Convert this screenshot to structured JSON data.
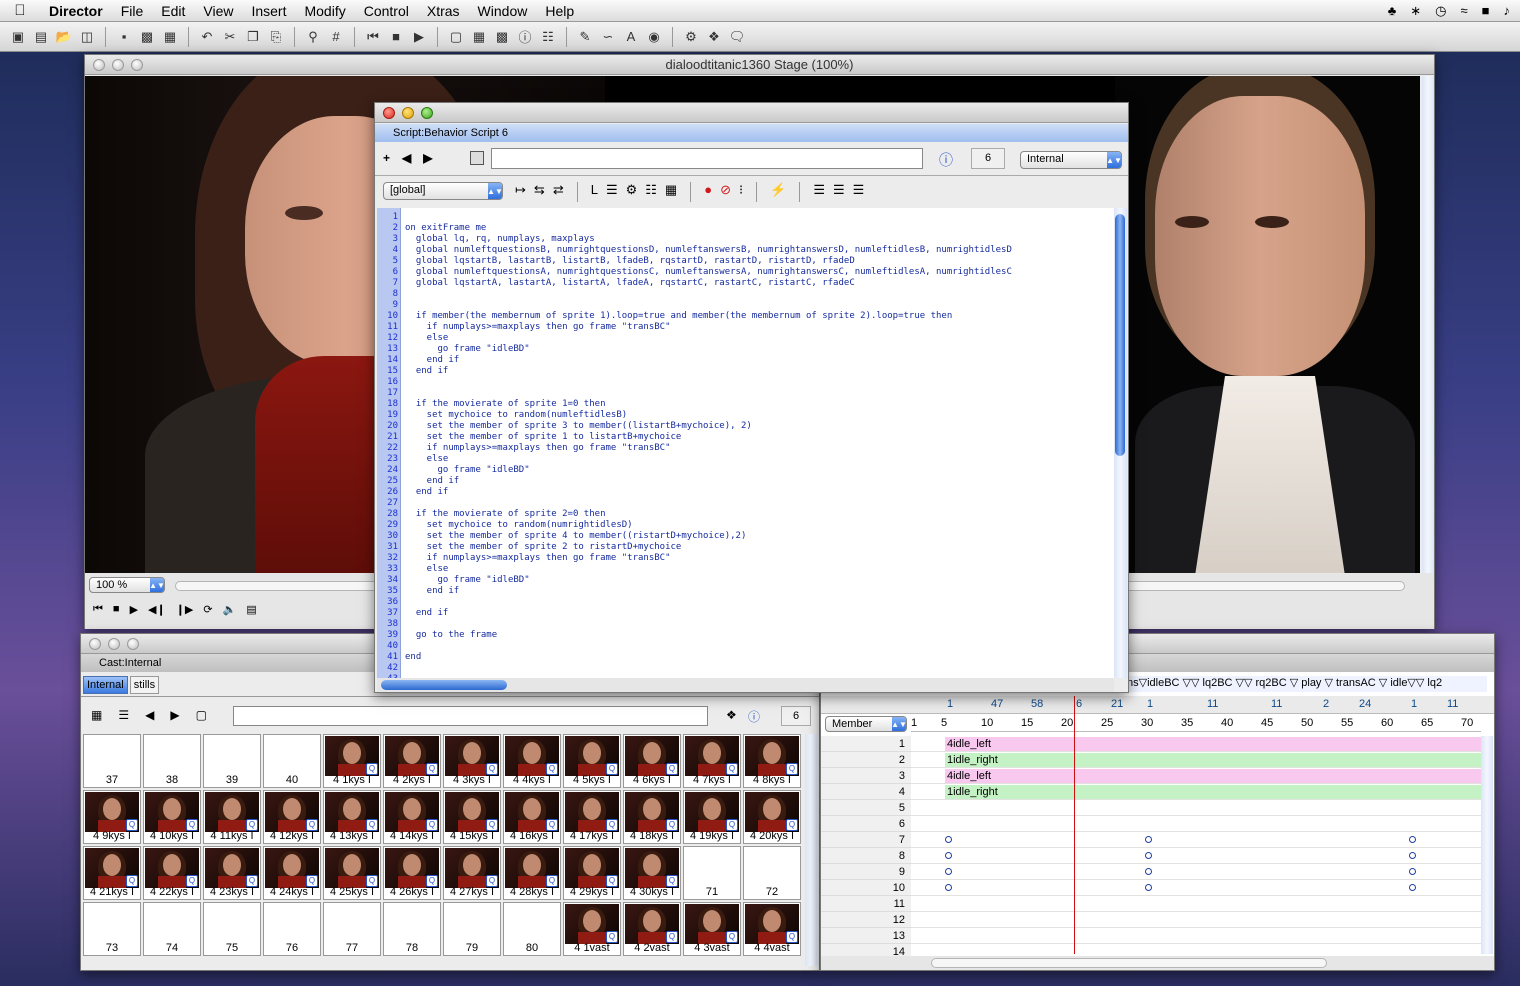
{
  "menubar": {
    "app": "Director",
    "items": [
      "File",
      "Edit",
      "View",
      "Insert",
      "Modify",
      "Control",
      "Xtras",
      "Window",
      "Help"
    ]
  },
  "stage": {
    "title": "dialoodtitanic1360 Stage (100%)",
    "zoom": "100 %"
  },
  "script": {
    "title": "Script:Behavior Script 6",
    "cast_number": "6",
    "cast_lib": "Internal",
    "handler_scope": "[global]",
    "line_numbers": [
      "1",
      "2",
      "3",
      "4",
      "5",
      "6",
      "7",
      "8",
      "9",
      "10",
      "11",
      "12",
      "13",
      "14",
      "15",
      "16",
      "17",
      "18",
      "19",
      "20",
      "21",
      "22",
      "23",
      "24",
      "25",
      "26",
      "27",
      "28",
      "29",
      "30",
      "31",
      "32",
      "33",
      "34",
      "35",
      "36",
      "37",
      "38",
      "39",
      "40",
      "41",
      "42",
      "43"
    ],
    "lines": [
      "",
      "on exitFrame me",
      "  global lq, rq, numplays, maxplays",
      "  global numleftquestionsB, numrightquestionsD, numleftanswersB, numrightanswersD, numleftidlesB, numrightidlesD",
      "  global lqstartB, lastartB, listartB, lfadeB, rqstartD, rastartD, ristartD, rfadeD",
      "  global numleftquestionsA, numrightquestionsC, numleftanswersA, numrightanswersC, numleftidlesA, numrightidlesC",
      "  global lqstartA, lastartA, listartA, lfadeA, rqstartC, rastartC, ristartC, rfadeC",
      "",
      "",
      "  if member(the membernum of sprite 1).loop=true and member(the membernum of sprite 2).loop=true then",
      "    if numplays>=maxplays then go frame \"transBC\"",
      "    else",
      "      go frame \"idleBD\"",
      "    end if",
      "  end if",
      "",
      "",
      "  if the movierate of sprite 1=0 then",
      "    set mychoice to random(numleftidlesB)",
      "    set the member of sprite 3 to member((listartB+mychoice), 2)",
      "    set the member of sprite 1 to listartB+mychoice",
      "    if numplays>=maxplays then go frame \"transBC\"",
      "    else",
      "      go frame \"idleBD\"",
      "    end if",
      "  end if",
      "",
      "  if the movierate of sprite 2=0 then",
      "    set mychoice to random(numrightidlesD)",
      "    set the member of sprite 4 to member((ristartD+mychoice),2)",
      "    set the member of sprite 2 to ristartD+mychoice",
      "    if numplays>=maxplays then go frame \"transBC\"",
      "    else",
      "      go frame \"idleBD\"",
      "    end if",
      "",
      "  end if",
      "",
      "  go to the frame",
      "",
      "end",
      "",
      ""
    ]
  },
  "cast": {
    "title": "Cast:Internal",
    "tabs": [
      "Internal",
      "stills"
    ],
    "number": "6",
    "rows": [
      [
        "37",
        "38",
        "39",
        "40",
        "4 1kys I",
        "4 2kys I",
        "4 3kys I",
        "4 4kys I",
        "4 5kys I",
        "4 6kys I",
        "4 7kys I",
        "4 8kys I"
      ],
      [
        "4 9kys I",
        "4 10kys I",
        "4 11kys I",
        "4 12kys I",
        "4 13kys I",
        "4 14kys I",
        "4 15kys I",
        "4 16kys I",
        "4 17kys I",
        "4 18kys I",
        "4 19kys I",
        "4 20kys I"
      ],
      [
        "4 21kys I",
        "4 22kys I",
        "4 23kys I",
        "4 24kys I",
        "4 25kys I",
        "4 26kys I",
        "4 27kys I",
        "4 28kys I",
        "4 29kys I",
        "4 30kys I",
        "71",
        "72"
      ],
      [
        "73",
        "74",
        "75",
        "76",
        "77",
        "78",
        "79",
        "80",
        "4 1vast",
        "4 2vast",
        "4 3vast",
        "4 4vast"
      ]
    ],
    "thumb_flags": [
      [
        false,
        false,
        false,
        false,
        true,
        true,
        true,
        true,
        true,
        true,
        true,
        true
      ],
      [
        true,
        true,
        true,
        true,
        true,
        true,
        true,
        true,
        true,
        true,
        true,
        true
      ],
      [
        true,
        true,
        true,
        true,
        true,
        true,
        true,
        true,
        true,
        true,
        false,
        false
      ],
      [
        false,
        false,
        false,
        false,
        false,
        false,
        false,
        false,
        true,
        true,
        true,
        true
      ]
    ]
  },
  "score": {
    "markers": "ns▽idleBC   ▽▽ lq2BC   ▽▽ rq2BC ▽ play ▽ transAC ▽ idle▽▽ lq2",
    "member_label": "Member",
    "tempo": [
      "1",
      "47",
      "58",
      "6",
      "21",
      "1",
      "11",
      "11",
      "2",
      "24",
      "1",
      "11"
    ],
    "frame_numbers": [
      "1",
      "5",
      "10",
      "15",
      "20",
      "25",
      "30",
      "35",
      "40",
      "45",
      "50",
      "55",
      "60",
      "65",
      "70"
    ],
    "channels": [
      "1",
      "2",
      "3",
      "4",
      "5",
      "6",
      "7",
      "8",
      "9",
      "10",
      "11",
      "12",
      "13",
      "14"
    ],
    "sprites": [
      "4idle_left",
      "1idle_right",
      "4idle_left",
      "1idle_right"
    ]
  },
  "colors": {
    "sprite_pink": "#f8c8ef",
    "sprite_green": "#c4f2c4",
    "playhead": "#d01010",
    "aqua": "#2f6fdd"
  }
}
